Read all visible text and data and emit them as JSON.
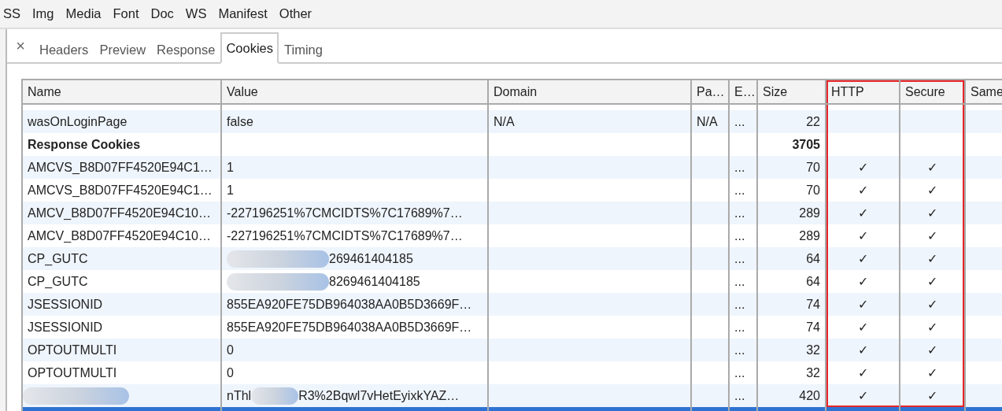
{
  "filters": [
    {
      "label": "SS"
    },
    {
      "label": "Img"
    },
    {
      "label": "Media"
    },
    {
      "label": "Font"
    },
    {
      "label": "Doc"
    },
    {
      "label": "WS"
    },
    {
      "label": "Manifest"
    },
    {
      "label": "Other"
    }
  ],
  "close": "×",
  "tabs": [
    {
      "label": "Headers",
      "selected": false
    },
    {
      "label": "Preview",
      "selected": false
    },
    {
      "label": "Response",
      "selected": false
    },
    {
      "label": "Cookies",
      "selected": true
    },
    {
      "label": "Timing",
      "selected": false
    }
  ],
  "columns": [
    {
      "label": "Name",
      "highlighted": false
    },
    {
      "label": "Value",
      "highlighted": false
    },
    {
      "label": "Domain",
      "highlighted": false
    },
    {
      "label": "Pa…",
      "highlighted": false
    },
    {
      "label": "E…",
      "highlighted": false
    },
    {
      "label": "Size",
      "highlighted": false
    },
    {
      "label": "HTTP",
      "highlighted": true
    },
    {
      "label": "Secure",
      "highlighted": true
    },
    {
      "label": "Same",
      "highlighted": false
    }
  ],
  "rows": [
    {
      "kind": "cookie",
      "selected": false,
      "name": [
        {
          "kind": "text",
          "text": "wasOnLoginPage"
        }
      ],
      "value": [
        {
          "kind": "text",
          "text": "false"
        }
      ],
      "domain": "N/A",
      "path": "N/A",
      "expires": "...",
      "size": "22"
    },
    {
      "kind": "group",
      "selected": false,
      "name": [
        {
          "kind": "text",
          "text": "Response Cookies"
        }
      ],
      "size": "3705"
    },
    {
      "kind": "cookie",
      "selected": false,
      "name": [
        {
          "kind": "text",
          "text": "AMCVS_B8D07FF4520E94C1…"
        }
      ],
      "value": [
        {
          "kind": "text",
          "text": "1"
        }
      ],
      "expires": "...",
      "size": "70",
      "http": "✓",
      "secure": "✓"
    },
    {
      "kind": "cookie",
      "selected": false,
      "name": [
        {
          "kind": "text",
          "text": "AMCVS_B8D07FF4520E94C1…"
        }
      ],
      "value": [
        {
          "kind": "text",
          "text": "1"
        }
      ],
      "expires": "...",
      "size": "70",
      "http": "✓",
      "secure": "✓"
    },
    {
      "kind": "cookie",
      "selected": false,
      "name": [
        {
          "kind": "text",
          "text": "AMCV_B8D07FF4520E94C10…"
        }
      ],
      "value": [
        {
          "kind": "text",
          "text": "-227196251%7CMCIDTS%7C17689%7…"
        }
      ],
      "expires": "...",
      "size": "289",
      "http": "✓",
      "secure": "✓"
    },
    {
      "kind": "cookie",
      "selected": false,
      "name": [
        {
          "kind": "text",
          "text": "AMCV_B8D07FF4520E94C10…"
        }
      ],
      "value": [
        {
          "kind": "text",
          "text": "-227196251%7CMCIDTS%7C17689%7…"
        }
      ],
      "expires": "...",
      "size": "289",
      "http": "✓",
      "secure": "✓"
    },
    {
      "kind": "cookie",
      "selected": false,
      "name": [
        {
          "kind": "text",
          "text": "CP_GUTC"
        }
      ],
      "value": [
        {
          "kind": "blur"
        },
        {
          "kind": "text",
          "text": "269461404185"
        }
      ],
      "expires": "...",
      "size": "64",
      "http": "✓",
      "secure": "✓"
    },
    {
      "kind": "cookie",
      "selected": false,
      "name": [
        {
          "kind": "text",
          "text": "CP_GUTC"
        }
      ],
      "value": [
        {
          "kind": "blur"
        },
        {
          "kind": "text",
          "text": "8269461404185"
        }
      ],
      "expires": "...",
      "size": "64",
      "http": "✓",
      "secure": "✓"
    },
    {
      "kind": "cookie",
      "selected": false,
      "name": [
        {
          "kind": "text",
          "text": "JSESSIONID"
        }
      ],
      "value": [
        {
          "kind": "text",
          "text": "855EA920FE75DB964038AA0B5D3669F…"
        }
      ],
      "expires": "...",
      "size": "74",
      "http": "✓",
      "secure": "✓"
    },
    {
      "kind": "cookie",
      "selected": false,
      "name": [
        {
          "kind": "text",
          "text": "JSESSIONID"
        }
      ],
      "value": [
        {
          "kind": "text",
          "text": "855EA920FE75DB964038AA0B5D3669F…"
        }
      ],
      "expires": "...",
      "size": "74",
      "http": "✓",
      "secure": "✓"
    },
    {
      "kind": "cookie",
      "selected": false,
      "name": [
        {
          "kind": "text",
          "text": "OPTOUTMULTI"
        }
      ],
      "value": [
        {
          "kind": "text",
          "text": "0"
        }
      ],
      "expires": "...",
      "size": "32",
      "http": "✓",
      "secure": "✓"
    },
    {
      "kind": "cookie",
      "selected": false,
      "name": [
        {
          "kind": "text",
          "text": "OPTOUTMULTI"
        }
      ],
      "value": [
        {
          "kind": "text",
          "text": "0"
        }
      ],
      "expires": "...",
      "size": "32",
      "http": "✓",
      "secure": "✓"
    },
    {
      "kind": "cookie",
      "selected": false,
      "name": [
        {
          "kind": "blur"
        }
      ],
      "value": [
        {
          "kind": "text",
          "text": "nThl"
        },
        {
          "kind": "blur"
        },
        {
          "kind": "text",
          "text": "R3%2Bqwl7vHetEyixkYAZ…"
        }
      ],
      "expires": "...",
      "size": "420",
      "http": "✓",
      "secure": "✓"
    },
    {
      "kind": "cookie",
      "selected": true
    }
  ]
}
